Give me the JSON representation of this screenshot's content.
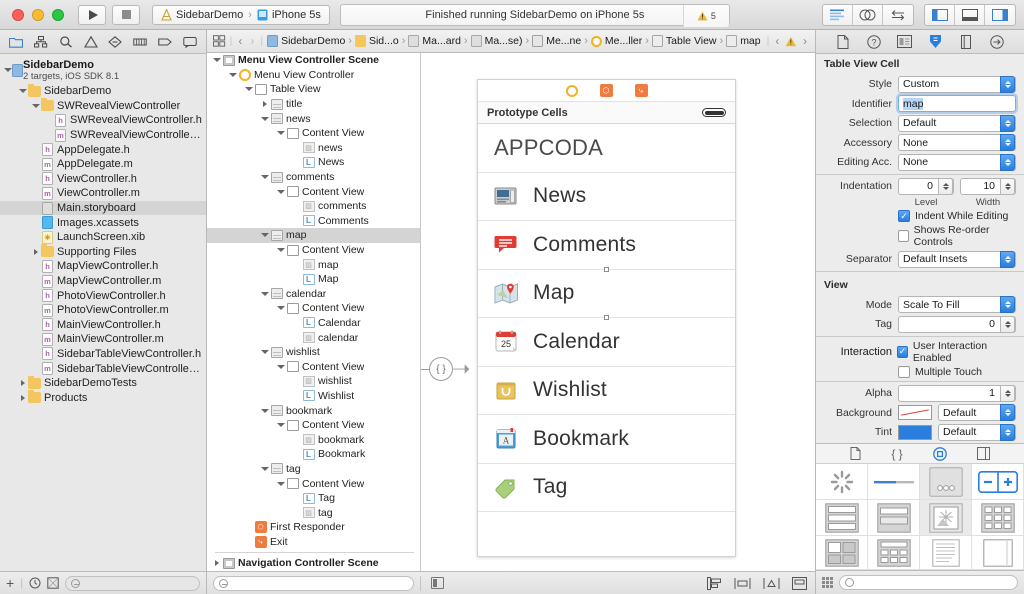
{
  "titlebar": {
    "run_label": "run-button",
    "stop_label": "stop-button",
    "scheme_project": "SidebarDemo",
    "scheme_device": "iPhone 5s",
    "status_text": "Finished running SidebarDemo on iPhone 5s",
    "warning_count": "5"
  },
  "navigator": {
    "tabs": [
      "folder-icon",
      "hierarchy-icon",
      "search-icon",
      "warning-icon",
      "breakpoint-icon",
      "report-icon",
      "tag-icon",
      "log-icon"
    ],
    "project": {
      "name": "SidebarDemo",
      "subtitle": "2 targets, iOS SDK 8.1"
    },
    "items": [
      {
        "label": "SidebarDemo",
        "depth": 1,
        "icon": "folder",
        "twisty": "open"
      },
      {
        "label": "SWRevealViewController",
        "depth": 2,
        "icon": "folder",
        "twisty": "open"
      },
      {
        "label": "SWRevealViewController.h",
        "depth": 3,
        "icon": "h",
        "twisty": "none"
      },
      {
        "label": "SWRevealViewController.m",
        "depth": 3,
        "icon": "m",
        "twisty": "none"
      },
      {
        "label": "AppDelegate.h",
        "depth": 2,
        "icon": "h",
        "twisty": "none"
      },
      {
        "label": "AppDelegate.m",
        "depth": 2,
        "icon": "m",
        "twisty": "none"
      },
      {
        "label": "ViewController.h",
        "depth": 2,
        "icon": "h",
        "twisty": "none"
      },
      {
        "label": "ViewController.m",
        "depth": 2,
        "icon": "m",
        "twisty": "none"
      },
      {
        "label": "Main.storyboard",
        "depth": 2,
        "icon": "sb",
        "twisty": "none",
        "selected": true
      },
      {
        "label": "Images.xcassets",
        "depth": 2,
        "icon": "xc",
        "twisty": "none"
      },
      {
        "label": "LaunchScreen.xib",
        "depth": 2,
        "icon": "xib",
        "twisty": "none"
      },
      {
        "label": "Supporting Files",
        "depth": 2,
        "icon": "folder",
        "twisty": "closed"
      },
      {
        "label": "MapViewController.h",
        "depth": 2,
        "icon": "h",
        "twisty": "none"
      },
      {
        "label": "MapViewController.m",
        "depth": 2,
        "icon": "m",
        "twisty": "none"
      },
      {
        "label": "PhotoViewController.h",
        "depth": 2,
        "icon": "h",
        "twisty": "none"
      },
      {
        "label": "PhotoViewController.m",
        "depth": 2,
        "icon": "m",
        "twisty": "none"
      },
      {
        "label": "MainViewController.h",
        "depth": 2,
        "icon": "h",
        "twisty": "none"
      },
      {
        "label": "MainViewController.m",
        "depth": 2,
        "icon": "m",
        "twisty": "none"
      },
      {
        "label": "SidebarTableViewController.h",
        "depth": 2,
        "icon": "h",
        "twisty": "none"
      },
      {
        "label": "SidebarTableViewController.m",
        "depth": 2,
        "icon": "m",
        "twisty": "none"
      },
      {
        "label": "SidebarDemoTests",
        "depth": 1,
        "icon": "folder",
        "twisty": "closed"
      },
      {
        "label": "Products",
        "depth": 1,
        "icon": "folder",
        "twisty": "closed"
      }
    ]
  },
  "jumpbar": {
    "back_label": "‹",
    "forward_label": "›",
    "crumbs": [
      {
        "label": "SidebarDemo",
        "icon": "project"
      },
      {
        "label": "Sid...o",
        "icon": "folder"
      },
      {
        "label": "Ma...ard",
        "icon": "storyboard"
      },
      {
        "label": "Ma...se)",
        "icon": "storyboard"
      },
      {
        "label": "Me...ne",
        "icon": "scene"
      },
      {
        "label": "Me...ller",
        "icon": "controller"
      },
      {
        "label": "Table View",
        "icon": "view"
      },
      {
        "label": "map",
        "icon": "cell"
      }
    ],
    "warning_icon": "warning-icon"
  },
  "outline": {
    "items": [
      {
        "label": "Menu View Controller Scene",
        "depth": 0,
        "icon": "scene",
        "twisty": "open",
        "bold": true
      },
      {
        "label": "Menu View Controller",
        "depth": 1,
        "icon": "circle",
        "twisty": "open"
      },
      {
        "label": "Table View",
        "depth": 2,
        "icon": "view",
        "twisty": "open"
      },
      {
        "label": "title",
        "depth": 3,
        "icon": "cell",
        "twisty": "closed"
      },
      {
        "label": "news",
        "depth": 3,
        "icon": "cell",
        "twisty": "open"
      },
      {
        "label": "Content View",
        "depth": 4,
        "icon": "view",
        "twisty": "open"
      },
      {
        "label": "news",
        "depth": 5,
        "icon": "image",
        "twisty": "none"
      },
      {
        "label": "News",
        "depth": 5,
        "icon": "label",
        "twisty": "none"
      },
      {
        "label": "comments",
        "depth": 3,
        "icon": "cell",
        "twisty": "open"
      },
      {
        "label": "Content View",
        "depth": 4,
        "icon": "view",
        "twisty": "open"
      },
      {
        "label": "comments",
        "depth": 5,
        "icon": "image",
        "twisty": "none"
      },
      {
        "label": "Comments",
        "depth": 5,
        "icon": "label",
        "twisty": "none"
      },
      {
        "label": "map",
        "depth": 3,
        "icon": "cell",
        "twisty": "open",
        "selected": true
      },
      {
        "label": "Content View",
        "depth": 4,
        "icon": "view",
        "twisty": "open"
      },
      {
        "label": "map",
        "depth": 5,
        "icon": "image",
        "twisty": "none"
      },
      {
        "label": "Map",
        "depth": 5,
        "icon": "label",
        "twisty": "none"
      },
      {
        "label": "calendar",
        "depth": 3,
        "icon": "cell",
        "twisty": "open"
      },
      {
        "label": "Content View",
        "depth": 4,
        "icon": "view",
        "twisty": "open"
      },
      {
        "label": "Calendar",
        "depth": 5,
        "icon": "label",
        "twisty": "none"
      },
      {
        "label": "calendar",
        "depth": 5,
        "icon": "image",
        "twisty": "none"
      },
      {
        "label": "wishlist",
        "depth": 3,
        "icon": "cell",
        "twisty": "open"
      },
      {
        "label": "Content View",
        "depth": 4,
        "icon": "view",
        "twisty": "open"
      },
      {
        "label": "wishlist",
        "depth": 5,
        "icon": "image",
        "twisty": "none"
      },
      {
        "label": "Wishlist",
        "depth": 5,
        "icon": "label",
        "twisty": "none"
      },
      {
        "label": "bookmark",
        "depth": 3,
        "icon": "cell",
        "twisty": "open"
      },
      {
        "label": "Content View",
        "depth": 4,
        "icon": "view",
        "twisty": "open"
      },
      {
        "label": "bookmark",
        "depth": 5,
        "icon": "image",
        "twisty": "none"
      },
      {
        "label": "Bookmark",
        "depth": 5,
        "icon": "label",
        "twisty": "none"
      },
      {
        "label": "tag",
        "depth": 3,
        "icon": "cell",
        "twisty": "open"
      },
      {
        "label": "Content View",
        "depth": 4,
        "icon": "view",
        "twisty": "open"
      },
      {
        "label": "Tag",
        "depth": 5,
        "icon": "label",
        "twisty": "none"
      },
      {
        "label": "tag",
        "depth": 5,
        "icon": "image",
        "twisty": "none"
      },
      {
        "label": "First Responder",
        "depth": 2,
        "icon": "first-responder",
        "twisty": "none"
      },
      {
        "label": "Exit",
        "depth": 2,
        "icon": "exit",
        "twisty": "none"
      },
      {
        "label": "SEPARATOR",
        "depth": 0,
        "icon": "separator",
        "twisty": "none"
      },
      {
        "label": "Navigation Controller Scene",
        "depth": 0,
        "icon": "scene",
        "twisty": "closed",
        "bold": true
      }
    ]
  },
  "canvas": {
    "prototype_label": "Prototype Cells",
    "header_title": "APPCODA",
    "cells": [
      {
        "label": "News",
        "icon": "news-icon"
      },
      {
        "label": "Comments",
        "icon": "comments-icon"
      },
      {
        "label": "Map",
        "icon": "map-icon"
      },
      {
        "label": "Calendar",
        "icon": "calendar-icon"
      },
      {
        "label": "Wishlist",
        "icon": "wishlist-icon"
      },
      {
        "label": "Bookmark",
        "icon": "bookmark-icon"
      },
      {
        "label": "Tag",
        "icon": "tag-icon"
      }
    ],
    "segue_glyph": "{ }"
  },
  "inspector": {
    "tabs": [
      "file-inspector-icon",
      "quick-help-icon",
      "identity-inspector-icon",
      "attributes-inspector-icon",
      "size-inspector-icon",
      "connections-inspector-icon"
    ],
    "active_tab_index": 3,
    "section_cell": {
      "title": "Table View Cell",
      "rows": [
        {
          "label": "Style",
          "value": "Custom",
          "type": "select"
        },
        {
          "label": "Identifier",
          "value": "map",
          "type": "text-focus"
        },
        {
          "label": "Selection",
          "value": "Default",
          "type": "select"
        },
        {
          "label": "Accessory",
          "value": "None",
          "type": "select"
        },
        {
          "label": "Editing Acc.",
          "value": "None",
          "type": "select"
        }
      ],
      "indentation_label": "Indentation",
      "indentation_level": "0",
      "indentation_width": "10",
      "sublabel_level": "Level",
      "sublabel_width": "Width",
      "checkbox_indent": {
        "label": "Indent While Editing",
        "checked": true
      },
      "checkbox_reorder": {
        "label": "Shows Re-order Controls",
        "checked": false
      },
      "separator_label": "Separator",
      "separator_value": "Default Insets"
    },
    "section_view": {
      "title": "View",
      "mode_label": "Mode",
      "mode_value": "Scale To Fill",
      "tag_label": "Tag",
      "tag_value": "0",
      "interaction_label": "Interaction",
      "checkbox_user_interaction": {
        "label": "User Interaction Enabled",
        "checked": true
      },
      "checkbox_multiple_touch": {
        "label": "Multiple Touch",
        "checked": false
      },
      "alpha_label": "Alpha",
      "alpha_value": "1",
      "background_label": "Background",
      "background_value": "Default",
      "tint_label": "Tint",
      "tint_value": "Default",
      "colors": {
        "tint_swatch": "#2a7ede",
        "background_swatch": "#ffffff"
      }
    },
    "library": {
      "tabs": [
        "file-template-library-icon",
        "code-snippet-library-icon",
        "object-library-icon",
        "media-library-icon"
      ],
      "active_tab_index": 2,
      "objects": [
        "activity-indicator-view",
        "progress-view",
        "page-control",
        "stepper",
        "table-view",
        "table-view-cell",
        "image-view",
        "collection-view",
        "collection-view-cell",
        "collection-reusable-view",
        "text-view",
        "scroll-view"
      ]
    }
  },
  "bottombar": {
    "add_label": "+",
    "filter_placeholder": "",
    "outline_filter_placeholder": "",
    "library_filter_placeholder": ""
  }
}
